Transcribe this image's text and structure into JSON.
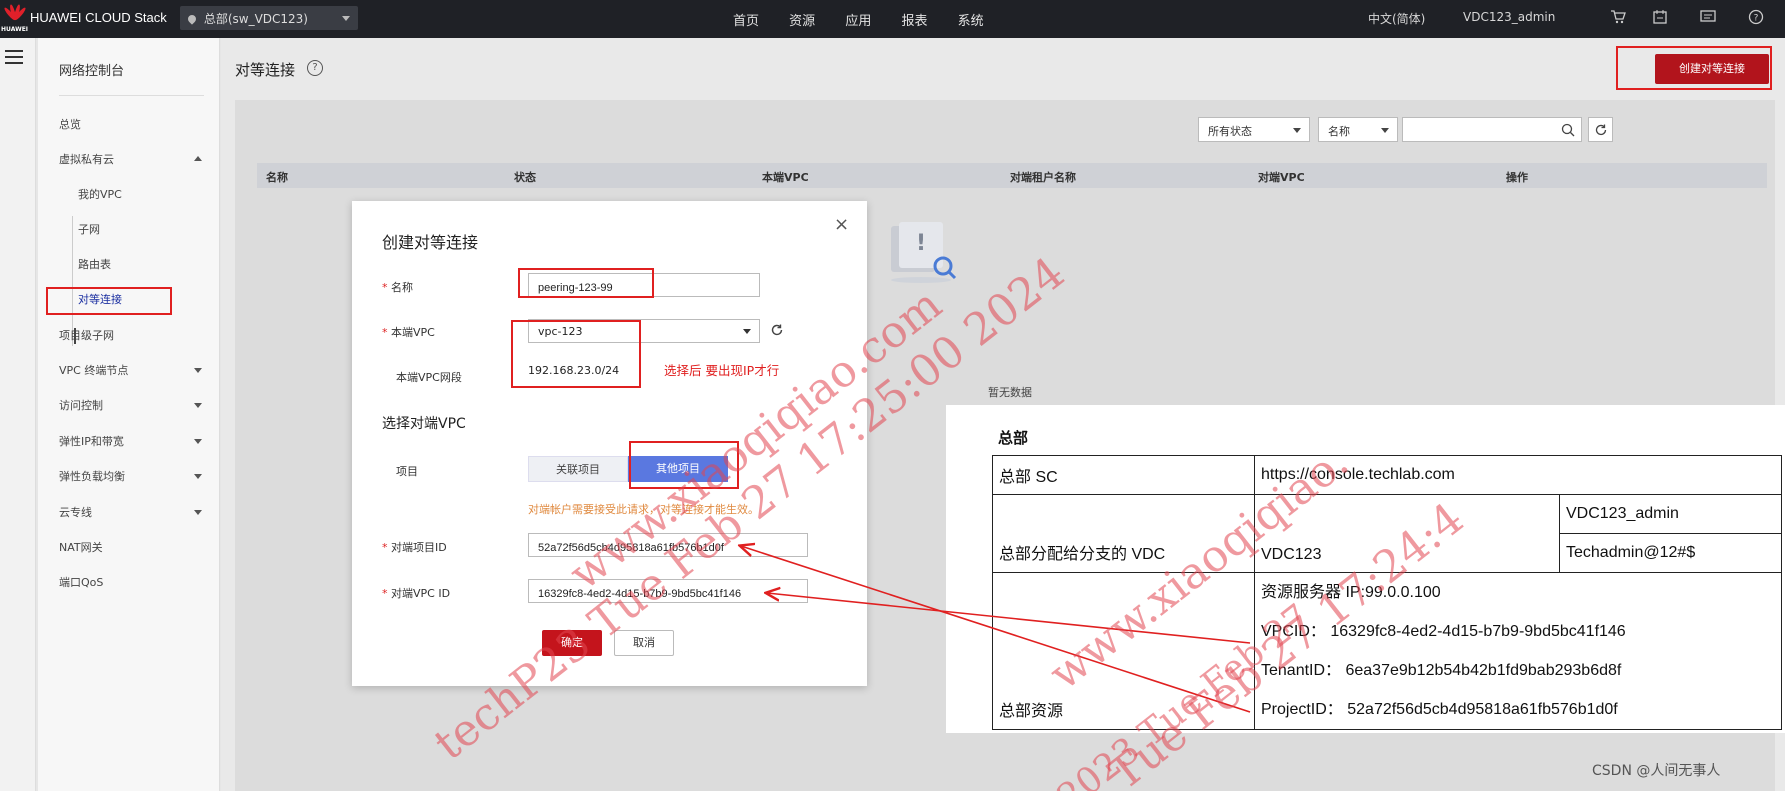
{
  "topbar": {
    "brand": "HUAWEI CLOUD Stack",
    "logo_text": "HUAWEI",
    "region": "总部(sw_VDC123)",
    "nav": [
      "首页",
      "资源",
      "应用",
      "报表",
      "系统"
    ],
    "language": "中文(简体)",
    "user": "VDC123_admin"
  },
  "sidebar": {
    "title": "网络控制台",
    "items": {
      "overview": "总览",
      "vpc_group": "虚拟私有云",
      "my_vpc": "我的VPC",
      "subnet": "子网",
      "route_table": "路由表",
      "peering": "对等连接",
      "project_subnet": "项目级子网",
      "vpc_endpoint": "VPC 终端节点",
      "access_control": "访问控制",
      "eip_bandwidth": "弹性IP和带宽",
      "elb": "弹性负载均衡",
      "direct_connect": "云专线",
      "nat": "NAT网关",
      "port_qos": "端口QoS"
    }
  },
  "main": {
    "title": "对等连接",
    "create_button": "创建对等连接",
    "status_filter": "所有状态",
    "search_field": "名称",
    "columns": [
      "名称",
      "状态",
      "本端VPC",
      "对端租户名称",
      "对端VPC",
      "操作"
    ],
    "empty_text": "暂无数据"
  },
  "dialog": {
    "title": "创建对等连接",
    "name_label": "名称",
    "name_value": "peering-123-99",
    "local_vpc_label": "本端VPC",
    "local_vpc_value": "vpc-123",
    "local_cidr_label": "本端VPC网段",
    "local_cidr_value": "192.168.23.0/24",
    "annotation": "选择后 要出现IP才行",
    "section_title": "选择对端VPC",
    "project_label": "项目",
    "project_options": [
      "关联项目",
      "其他项目"
    ],
    "warning": "对端帐户需要接受此请求，对等连接才能生效。",
    "peer_project_id_label": "对端项目ID",
    "peer_project_id_value": "52a72f56d5cb4d95818a61fb576b1d0f",
    "peer_vpc_id_label": "对端VPC ID",
    "peer_vpc_id_value": "16329fc8-4ed2-4d15-b7b9-9bd5bc41f146",
    "ok": "确定",
    "cancel": "取消"
  },
  "info": {
    "title": "总部",
    "rows": {
      "sc_label": "总部 SC",
      "sc_value": "https://console.techlab.com",
      "vdc_label": "总部分配给分支的 VDC",
      "vdc_value": "VDC123",
      "vdc_user": "VDC123_admin",
      "vdc_password": "Techadmin@12#$",
      "res_label": "总部资源",
      "res_server": "资源服务器 IP:99.0.0.100",
      "res_vpcid": "VPCID：  16329fc8-4ed2-4d15-b7b9-9bd5bc41f146",
      "res_tenant": "TenantID：  6ea37e9b12b54b42b1fd9bab293b6d8f",
      "res_project": "ProjectID：  52a72f56d5cb4d95818a61fb576b1d0f"
    }
  },
  "watermarks": [
    "techP23 Tue Feb 27 17:25:00 2024",
    "www.xiaoqiqiao.com",
    "www.xiaoqiqiao.",
    "Tue Feb 27 17:24:4",
    "2023 Tue Feb 27"
  ],
  "footer": "CSDN @人间无事人",
  "colors": {
    "accent_red": "#c4141c",
    "annotation_red": "#e02020",
    "selected_blue": "#5a78e0",
    "topbar": "#1f2126"
  }
}
